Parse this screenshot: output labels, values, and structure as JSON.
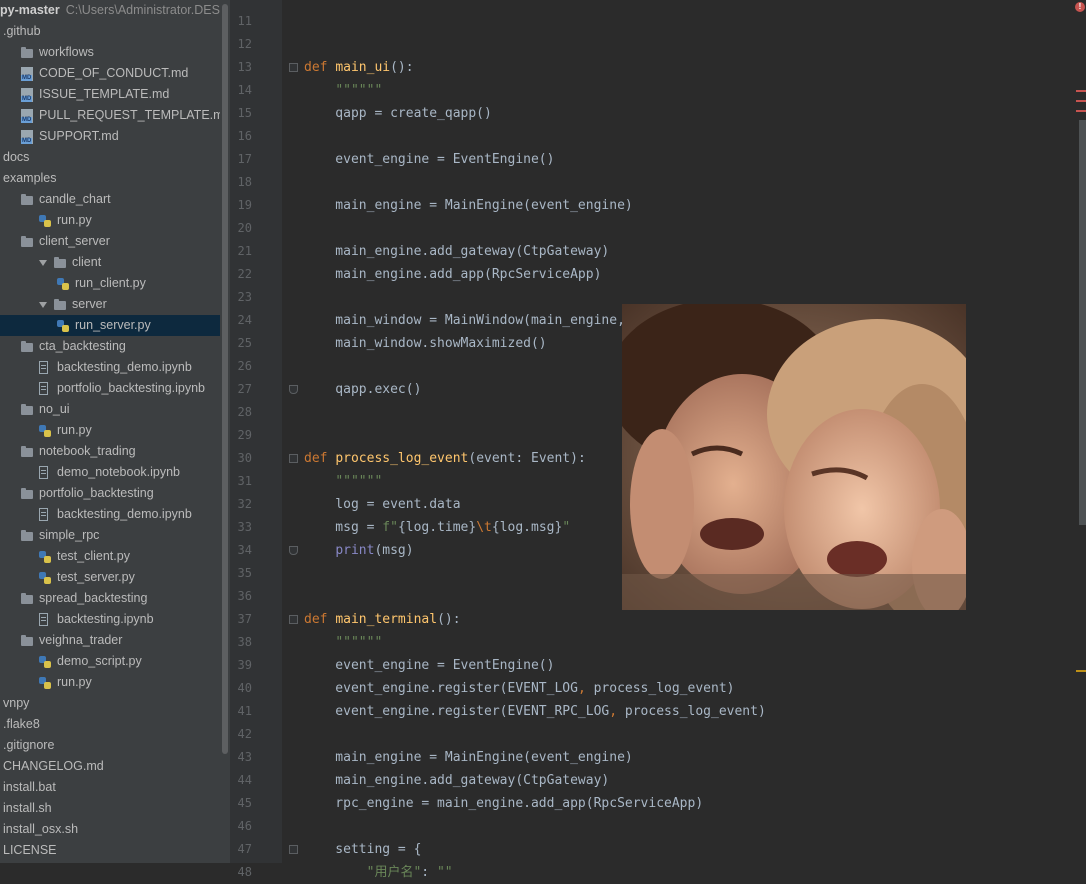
{
  "project": {
    "name": "py-master",
    "path": "C:\\Users\\Administrator.DESK"
  },
  "tree": [
    {
      "label": "github",
      "prefix": ".",
      "icon": "none",
      "indent": 0
    },
    {
      "label": "workflows",
      "icon": "folder-icon",
      "indent": 1
    },
    {
      "label": "CODE_OF_CONDUCT.md",
      "icon": "md-icon",
      "indent": 1
    },
    {
      "label": "ISSUE_TEMPLATE.md",
      "icon": "md-icon",
      "indent": 1
    },
    {
      "label": "PULL_REQUEST_TEMPLATE.md",
      "icon": "md-icon",
      "indent": 1
    },
    {
      "label": "SUPPORT.md",
      "icon": "md-icon",
      "indent": 1
    },
    {
      "label": "docs",
      "icon": "none",
      "indent": 0
    },
    {
      "label": "examples",
      "icon": "none",
      "indent": 0
    },
    {
      "label": "candle_chart",
      "icon": "folder-icon",
      "indent": 1
    },
    {
      "label": "run.py",
      "icon": "py-icon",
      "indent": 2
    },
    {
      "label": "client_server",
      "icon": "folder-icon",
      "indent": 1
    },
    {
      "label": "client",
      "icon": "folder-icon",
      "indent": 2,
      "expanded": true
    },
    {
      "label": "run_client.py",
      "icon": "py-icon",
      "indent": 3
    },
    {
      "label": "server",
      "icon": "folder-icon",
      "indent": 2,
      "expanded": true
    },
    {
      "label": "run_server.py",
      "icon": "py-icon",
      "indent": 3,
      "selected": true
    },
    {
      "label": "cta_backtesting",
      "icon": "folder-icon",
      "indent": 1
    },
    {
      "label": "backtesting_demo.ipynb",
      "icon": "nb-icon",
      "indent": 2
    },
    {
      "label": "portfolio_backtesting.ipynb",
      "icon": "nb-icon",
      "indent": 2
    },
    {
      "label": "no_ui",
      "icon": "folder-icon",
      "indent": 1
    },
    {
      "label": "run.py",
      "icon": "py-icon",
      "indent": 2
    },
    {
      "label": "notebook_trading",
      "icon": "folder-icon",
      "indent": 1
    },
    {
      "label": "demo_notebook.ipynb",
      "icon": "nb-icon",
      "indent": 2
    },
    {
      "label": "portfolio_backtesting",
      "icon": "folder-icon",
      "indent": 1
    },
    {
      "label": "backtesting_demo.ipynb",
      "icon": "nb-icon",
      "indent": 2
    },
    {
      "label": "simple_rpc",
      "icon": "folder-icon",
      "indent": 1
    },
    {
      "label": "test_client.py",
      "icon": "py-icon",
      "indent": 2
    },
    {
      "label": "test_server.py",
      "icon": "py-icon",
      "indent": 2
    },
    {
      "label": "spread_backtesting",
      "icon": "folder-icon",
      "indent": 1
    },
    {
      "label": "backtesting.ipynb",
      "icon": "nb-icon",
      "indent": 2
    },
    {
      "label": "veighna_trader",
      "icon": "folder-icon",
      "indent": 1
    },
    {
      "label": "demo_script.py",
      "icon": "py-icon",
      "indent": 2
    },
    {
      "label": "run.py",
      "icon": "py-icon",
      "indent": 2
    },
    {
      "label": "vnpy",
      "icon": "none",
      "indent": 0
    },
    {
      "label": ".flake8",
      "icon": "none",
      "indent": 0
    },
    {
      "label": ".gitignore",
      "icon": "none",
      "indent": 0
    },
    {
      "label": "CHANGELOG.md",
      "icon": "none",
      "indent": 0
    },
    {
      "label": "install.bat",
      "icon": "none",
      "indent": 0
    },
    {
      "label": "install.sh",
      "icon": "none",
      "indent": 0
    },
    {
      "label": "install_osx.sh",
      "icon": "none",
      "indent": 0
    },
    {
      "label": "LICENSE",
      "icon": "none",
      "indent": 0
    }
  ],
  "code_lines": [
    {
      "n": "11",
      "html": ""
    },
    {
      "n": "12",
      "html": ""
    },
    {
      "n": "13",
      "html": "<span class=\"kw\">def </span><span class=\"fn\">main_ui</span>():",
      "fold": "open"
    },
    {
      "n": "14",
      "html": "    <span class=\"str\">\"\"\"\"\"\"</span>"
    },
    {
      "n": "15",
      "html": "    qapp = create_qapp()"
    },
    {
      "n": "16",
      "html": ""
    },
    {
      "n": "17",
      "html": "    event_engine = EventEngine()"
    },
    {
      "n": "18",
      "html": ""
    },
    {
      "n": "19",
      "html": "    main_engine = MainEngine(event_engine)"
    },
    {
      "n": "20",
      "html": ""
    },
    {
      "n": "21",
      "html": "    main_engine.add_gateway(CtpGateway)"
    },
    {
      "n": "22",
      "html": "    main_engine.add_app(RpcServiceApp)"
    },
    {
      "n": "23",
      "html": ""
    },
    {
      "n": "24",
      "html": "    main_window = MainWindow(main_engine, event_engine)"
    },
    {
      "n": "25",
      "html": "    main_window.showMaximized()"
    },
    {
      "n": "26",
      "html": ""
    },
    {
      "n": "27",
      "html": "    qapp.exec()",
      "fold": "close"
    },
    {
      "n": "28",
      "html": ""
    },
    {
      "n": "29",
      "html": ""
    },
    {
      "n": "30",
      "html": "<span class=\"kw\">def </span><span class=\"fn\">process_log_event</span>(event: Event):",
      "fold": "open"
    },
    {
      "n": "31",
      "html": "    <span class=\"str\">\"\"\"\"\"\"</span>"
    },
    {
      "n": "32",
      "html": "    log = event.data"
    },
    {
      "n": "33",
      "html": "    msg = <span class=\"str\">f\"</span>{log.time}<span class=\"kw\">\\t</span>{log.msg}<span class=\"str\">\"</span>"
    },
    {
      "n": "34",
      "html": "    <span class=\"bi\">print</span>(msg)",
      "fold": "close"
    },
    {
      "n": "35",
      "html": ""
    },
    {
      "n": "36",
      "html": ""
    },
    {
      "n": "37",
      "html": "<span class=\"kw\">def </span><span class=\"fn\">main_terminal</span>():",
      "fold": "open"
    },
    {
      "n": "38",
      "html": "    <span class=\"str\">\"\"\"\"\"\"</span>"
    },
    {
      "n": "39",
      "html": "    event_engine = EventEngine()"
    },
    {
      "n": "40",
      "html": "    event_engine.register(EVENT_LOG<span class=\"kw\">, </span>process_log_event)"
    },
    {
      "n": "41",
      "html": "    event_engine.register(EVENT_RPC_LOG<span class=\"kw\">, </span>process_log_event)"
    },
    {
      "n": "42",
      "html": ""
    },
    {
      "n": "43",
      "html": "    main_engine = MainEngine(event_engine)"
    },
    {
      "n": "44",
      "html": "    main_engine.add_gateway(CtpGateway)"
    },
    {
      "n": "45",
      "html": "    rpc_engine = main_engine.add_app(RpcServiceApp)"
    },
    {
      "n": "46",
      "html": ""
    },
    {
      "n": "47",
      "html": "    setting = {",
      "fold": "open"
    },
    {
      "n": "48",
      "html": "        <span class=\"str\">\"用户名\"</span>: <span class=\"str\">\"\"</span>"
    }
  ],
  "overlay_image": {
    "description_icon": "photo-icon"
  },
  "colors": {
    "accent_error": "#c75450",
    "selection": "#0d293e"
  }
}
